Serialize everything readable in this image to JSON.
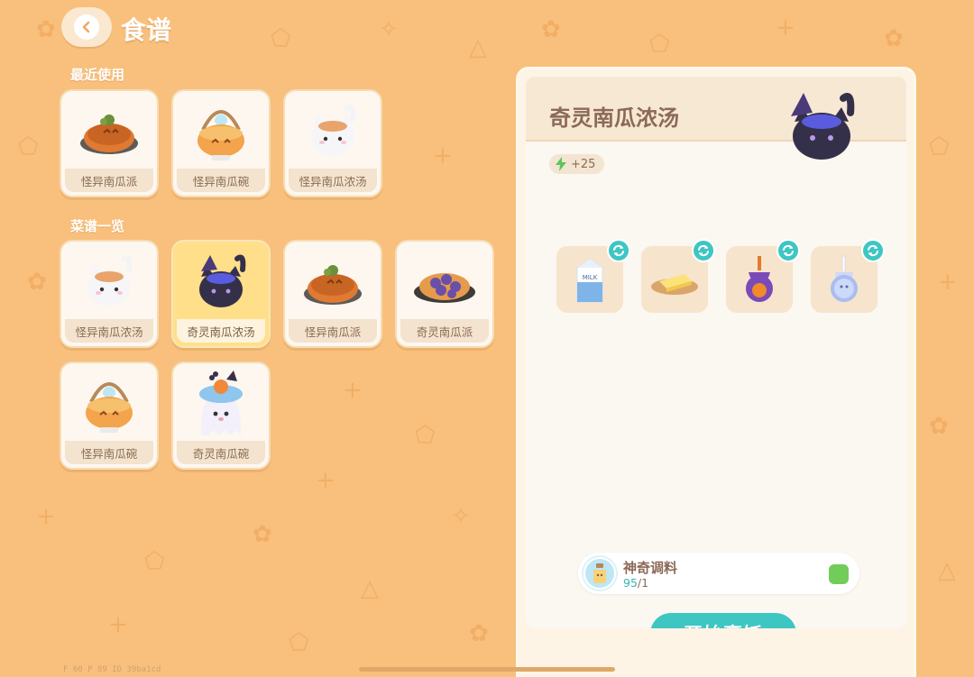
{
  "header": {
    "title": "食谱",
    "back_icon": "chevron-left-icon"
  },
  "sections": {
    "recent": {
      "title": "最近使用",
      "items": [
        {
          "label": "怪异南瓜派",
          "icon": "pumpkin-pie-icon"
        },
        {
          "label": "怪异南瓜碗",
          "icon": "pumpkin-bowl-icon"
        },
        {
          "label": "怪异南瓜浓汤",
          "icon": "white-cat-pot-icon"
        }
      ]
    },
    "all": {
      "title": "菜谱一览",
      "items": [
        {
          "label": "怪异南瓜浓汤",
          "icon": "white-cat-pot-icon",
          "selected": false
        },
        {
          "label": "奇灵南瓜浓汤",
          "icon": "black-cat-pot-icon",
          "selected": true
        },
        {
          "label": "怪异南瓜派",
          "icon": "pumpkin-pie-icon",
          "selected": false
        },
        {
          "label": "奇灵南瓜派",
          "icon": "berry-pie-icon",
          "selected": false
        },
        {
          "label": "怪异南瓜碗",
          "icon": "pumpkin-bowl-icon",
          "selected": false
        },
        {
          "label": "奇灵南瓜碗",
          "icon": "ghost-cake-icon",
          "selected": false
        }
      ]
    }
  },
  "detail": {
    "name": "奇灵南瓜浓汤",
    "energy": "+25",
    "ingredients": [
      {
        "name": "milk-carton",
        "icon": "milk-carton-icon",
        "carton_text": "MILK"
      },
      {
        "name": "butter",
        "icon": "butter-icon"
      },
      {
        "name": "pumpkin-jar",
        "icon": "pumpkin-jar-icon"
      },
      {
        "name": "blue-jar",
        "icon": "blue-jar-icon"
      }
    ],
    "seasoning": {
      "name": "神奇调料",
      "have": "95",
      "need": "/1"
    },
    "cook_button": "开始烹饪"
  },
  "debug": {
    "text": "F 60   P 89   ID 39ba1cd"
  },
  "colors": {
    "background": "#f8c07c",
    "accent": "#3ec6c3",
    "panel": "#fdf4e6"
  }
}
